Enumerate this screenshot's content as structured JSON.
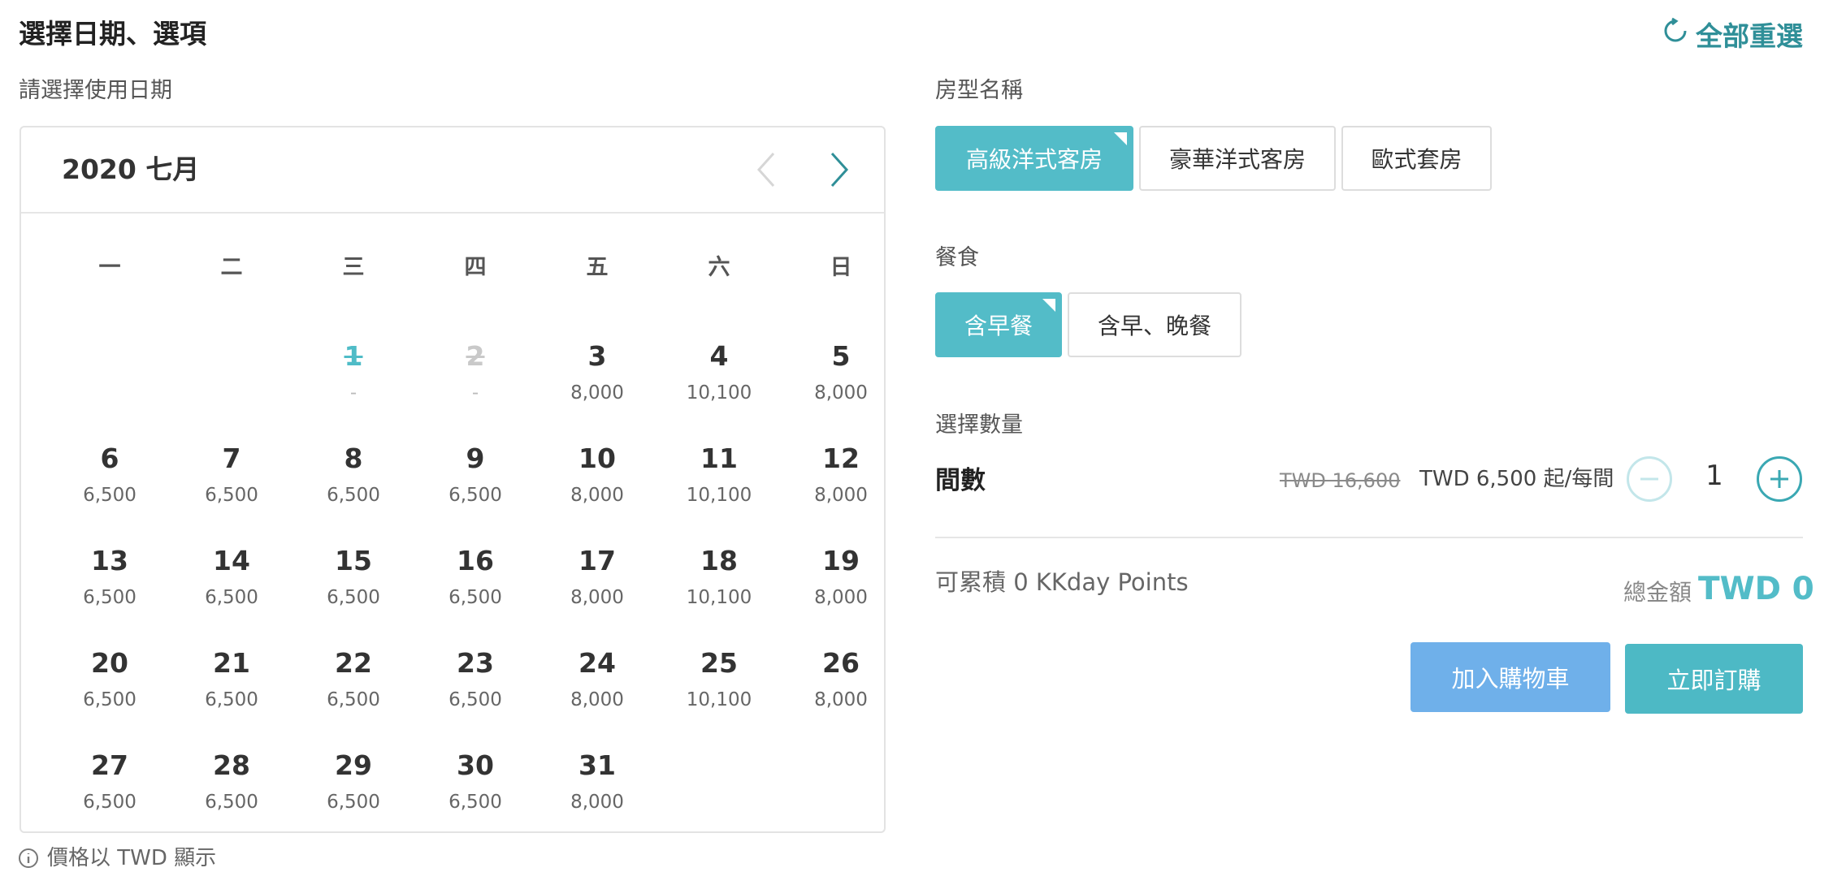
{
  "header": {
    "title": "選擇日期、選項",
    "reset_label": "全部重選"
  },
  "calendar": {
    "date_label": "請選擇使用日期",
    "month_label": "2020 七月",
    "weekdays": [
      "一",
      "二",
      "三",
      "四",
      "五",
      "六",
      "日"
    ],
    "weeks": [
      [
        null,
        null,
        {
          "day": "1",
          "price": "-",
          "state": "selected"
        },
        {
          "day": "2",
          "price": "-",
          "state": "disabled"
        },
        {
          "day": "3",
          "price": "8,000"
        },
        {
          "day": "4",
          "price": "10,100"
        },
        {
          "day": "5",
          "price": "8,000"
        }
      ],
      [
        {
          "day": "6",
          "price": "6,500"
        },
        {
          "day": "7",
          "price": "6,500"
        },
        {
          "day": "8",
          "price": "6,500"
        },
        {
          "day": "9",
          "price": "6,500"
        },
        {
          "day": "10",
          "price": "8,000"
        },
        {
          "day": "11",
          "price": "10,100"
        },
        {
          "day": "12",
          "price": "8,000"
        }
      ],
      [
        {
          "day": "13",
          "price": "6,500"
        },
        {
          "day": "14",
          "price": "6,500"
        },
        {
          "day": "15",
          "price": "6,500"
        },
        {
          "day": "16",
          "price": "6,500"
        },
        {
          "day": "17",
          "price": "8,000"
        },
        {
          "day": "18",
          "price": "10,100"
        },
        {
          "day": "19",
          "price": "8,000"
        }
      ],
      [
        {
          "day": "20",
          "price": "6,500"
        },
        {
          "day": "21",
          "price": "6,500"
        },
        {
          "day": "22",
          "price": "6,500"
        },
        {
          "day": "23",
          "price": "6,500"
        },
        {
          "day": "24",
          "price": "8,000"
        },
        {
          "day": "25",
          "price": "10,100"
        },
        {
          "day": "26",
          "price": "8,000"
        }
      ],
      [
        {
          "day": "27",
          "price": "6,500"
        },
        {
          "day": "28",
          "price": "6,500"
        },
        {
          "day": "29",
          "price": "6,500"
        },
        {
          "day": "30",
          "price": "6,500"
        },
        {
          "day": "31",
          "price": "8,000"
        },
        null,
        null
      ]
    ],
    "footnote": "價格以 TWD 顯示"
  },
  "room_type": {
    "label": "房型名稱",
    "options": [
      "高級洋式客房",
      "豪華洋式客房",
      "歐式套房"
    ],
    "selected_index": 0
  },
  "meal": {
    "label": "餐食",
    "options": [
      "含早餐",
      "含早、晚餐"
    ],
    "selected_index": 0
  },
  "quantity": {
    "label": "選擇數量",
    "unit_title": "間數",
    "old_price": "TWD 16,600",
    "price": "TWD 6,500 起/每間",
    "value": "1"
  },
  "summary": {
    "points_text": "可累積 0 KKday Points",
    "total_label": "總金額",
    "total_value": "TWD 0"
  },
  "actions": {
    "add_to_cart": "加入購物車",
    "buy_now": "立即訂購"
  },
  "colors": {
    "accent": "#53bcc8",
    "accent_dark": "#2f8f98",
    "cart_blue": "#6fb0ea"
  }
}
